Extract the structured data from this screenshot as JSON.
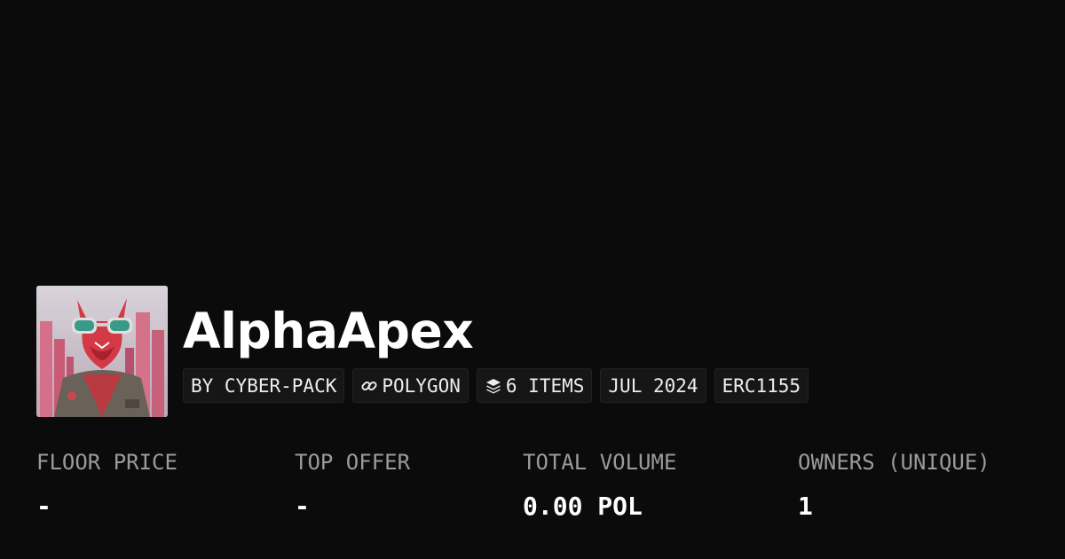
{
  "collection": {
    "name": "AlphaApex",
    "avatar_icon": "wolf-character-avatar"
  },
  "chips": {
    "creator": "BY CYBER-PACK",
    "chain": "POLYGON",
    "chain_icon": "link-icon",
    "items": "6 ITEMS",
    "items_icon": "layers-icon",
    "date": "JUL 2024",
    "standard": "ERC1155"
  },
  "stats": {
    "floor_price": {
      "label": "FLOOR PRICE",
      "value": "-"
    },
    "top_offer": {
      "label": "TOP OFFER",
      "value": "-"
    },
    "total_volume": {
      "label": "TOTAL VOLUME",
      "value": "0.00 POL"
    },
    "owners": {
      "label": "OWNERS (UNIQUE)",
      "value": "1"
    }
  },
  "colors": {
    "background": "#0b0b0b",
    "chip_background": "#161616",
    "label": "#9b9b9b",
    "value": "#ffffff"
  }
}
